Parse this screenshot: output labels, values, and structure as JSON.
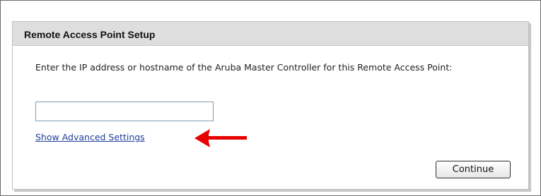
{
  "panel": {
    "title": "Remote Access Point Setup",
    "instructions": "Enter the IP address or hostname of the Aruba Master Controller for this Remote Access Point:",
    "host_input": {
      "value": "",
      "placeholder": ""
    },
    "advanced_link": "Show Advanced Settings",
    "continue_label": "Continue"
  },
  "annotation": {
    "arrow_color": "#e60000",
    "arrow_icon": "left-arrow-icon"
  },
  "colors": {
    "header_bg": "#dedede",
    "link": "#1f3f9a"
  }
}
